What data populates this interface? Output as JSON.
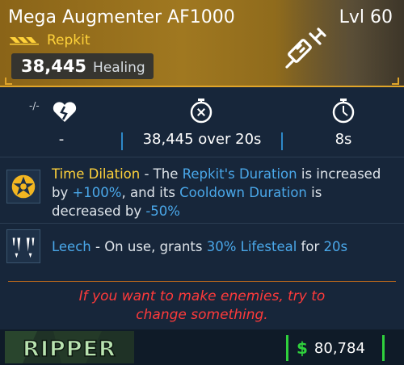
{
  "header": {
    "item_name": "Mega Augmenter AF1000",
    "level": "Lvl 60",
    "item_type": "Repkit",
    "rarity_icon": "triple-chevron-icon",
    "primary_stat": {
      "value": "38,445",
      "label": "Healing"
    },
    "item_icon": "syringe-icon",
    "accent_color": "#e0a52a"
  },
  "stats": {
    "mod_label": "-/-",
    "columns": [
      {
        "icon": "broken-heart-icon",
        "value": "-"
      },
      {
        "icon": "stopwatch-heal-icon",
        "value": "38,445 over 20s"
      },
      {
        "icon": "stopwatch-icon",
        "value": "8s"
      }
    ]
  },
  "perks": [
    {
      "icon": "star-badge-icon",
      "name": "Time Dilation",
      "segments": [
        {
          "text": "Time Dilation",
          "style": "name"
        },
        {
          "text": " - The ",
          "style": "plain"
        },
        {
          "text": "Repkit's Duration",
          "style": "kw"
        },
        {
          "text": " is increased by ",
          "style": "plain"
        },
        {
          "text": "+100%",
          "style": "kw"
        },
        {
          "text": ", and its ",
          "style": "plain"
        },
        {
          "text": "Cooldown Duration",
          "style": "kw"
        },
        {
          "text": " is decreased by ",
          "style": "plain"
        },
        {
          "text": "-50%",
          "style": "kw"
        }
      ]
    },
    {
      "icon": "fangs-icon",
      "name": "Leech",
      "segments": [
        {
          "text": "Leech",
          "style": "kw"
        },
        {
          "text": " - On use, grants ",
          "style": "plain"
        },
        {
          "text": "30% Lifesteal",
          "style": "kw"
        },
        {
          "text": " for ",
          "style": "plain"
        },
        {
          "text": "20s",
          "style": "kw"
        }
      ]
    }
  ],
  "flavor": {
    "line1": "If you want to make enemies, try to",
    "line2": "change something."
  },
  "footer": {
    "manufacturer": "RIPPER",
    "currency_symbol": "$",
    "price": "80,784",
    "price_color": "#2fd13c"
  }
}
